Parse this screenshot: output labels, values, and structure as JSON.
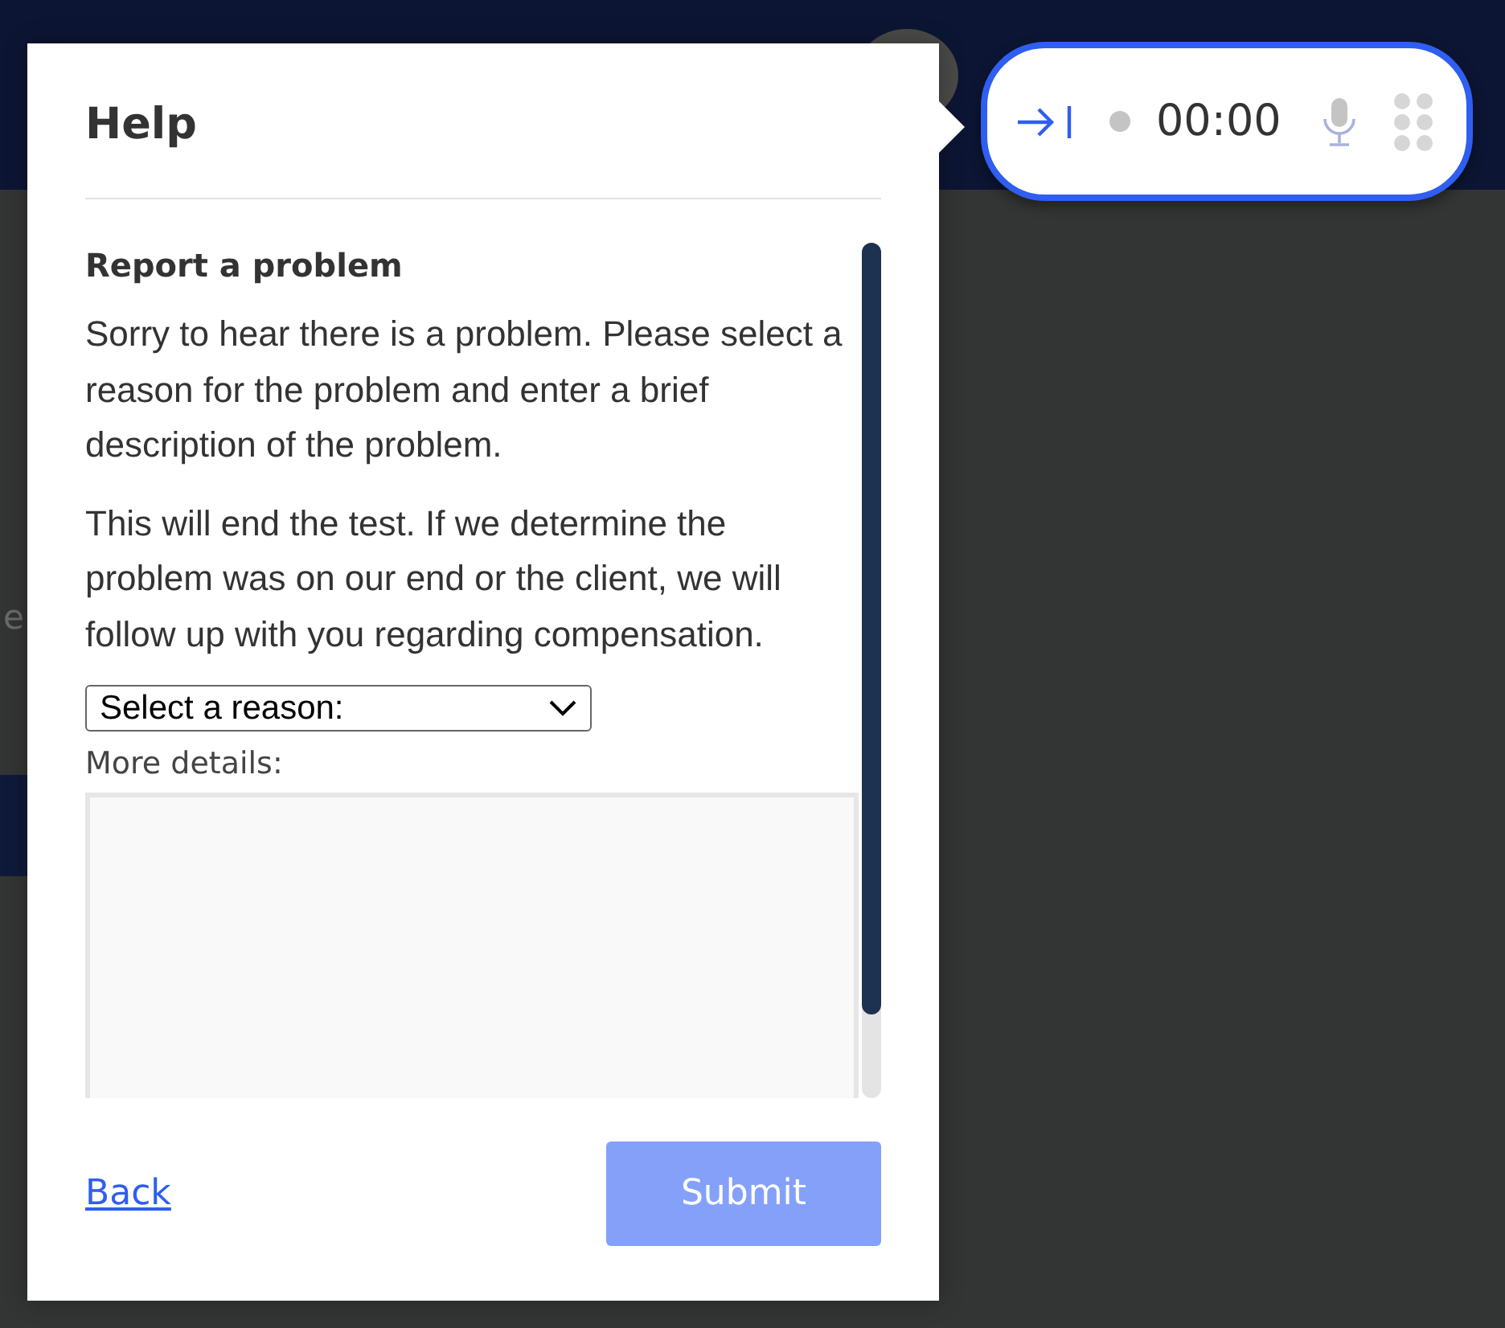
{
  "background": {
    "text_fragment": "e"
  },
  "dialog": {
    "title": "Help",
    "heading": "Report a problem",
    "paragraphs": [
      "Sorry to hear there is a problem. Please select a reason for the problem and enter a brief description of the problem.",
      "This will end the test. If we determine the problem was on our end or the client, we will follow up with you regarding compensation."
    ],
    "reason_select": {
      "value": "Select a reason:"
    },
    "details_label": "More details:",
    "back_link": "Back",
    "submit_button": {
      "label": "Submit",
      "disabled": true
    }
  },
  "recorder": {
    "time": "00:00"
  }
}
